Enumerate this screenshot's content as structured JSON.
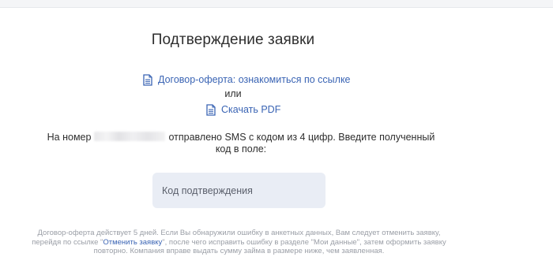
{
  "page": {
    "title": "Подтверждение заявки"
  },
  "documents": {
    "offer_link": "Договор-оферта: ознакомиться по ссылке",
    "or_text": "или",
    "pdf_link": "Скачать PDF",
    "icon": "document-icon"
  },
  "sms": {
    "prefix": "На номер",
    "phone_masked": "",
    "suffix": "отправлено SMS с кодом из 4 цифр. Введите полученный код в поле:"
  },
  "code_input": {
    "placeholder": "Код подтверждения",
    "value": ""
  },
  "footnote": {
    "part1": "Договор-оферта действует 5 дней. Если Вы обнаружили ошибку в анкетных данных, Вам следует отменить заявку, перейдя по ссылке \"",
    "cancel_link": "Отменить заявку",
    "part2": "\", после чего исправить ошибку в разделе \"Мои данные\", затем оформить заявку повторно. Компания вправе выдать сумму займа в размере ниже, чем заявленная."
  },
  "colors": {
    "link": "#3a64b4",
    "input_bg": "#e9edf5",
    "muted_text": "#9a9ea6"
  }
}
